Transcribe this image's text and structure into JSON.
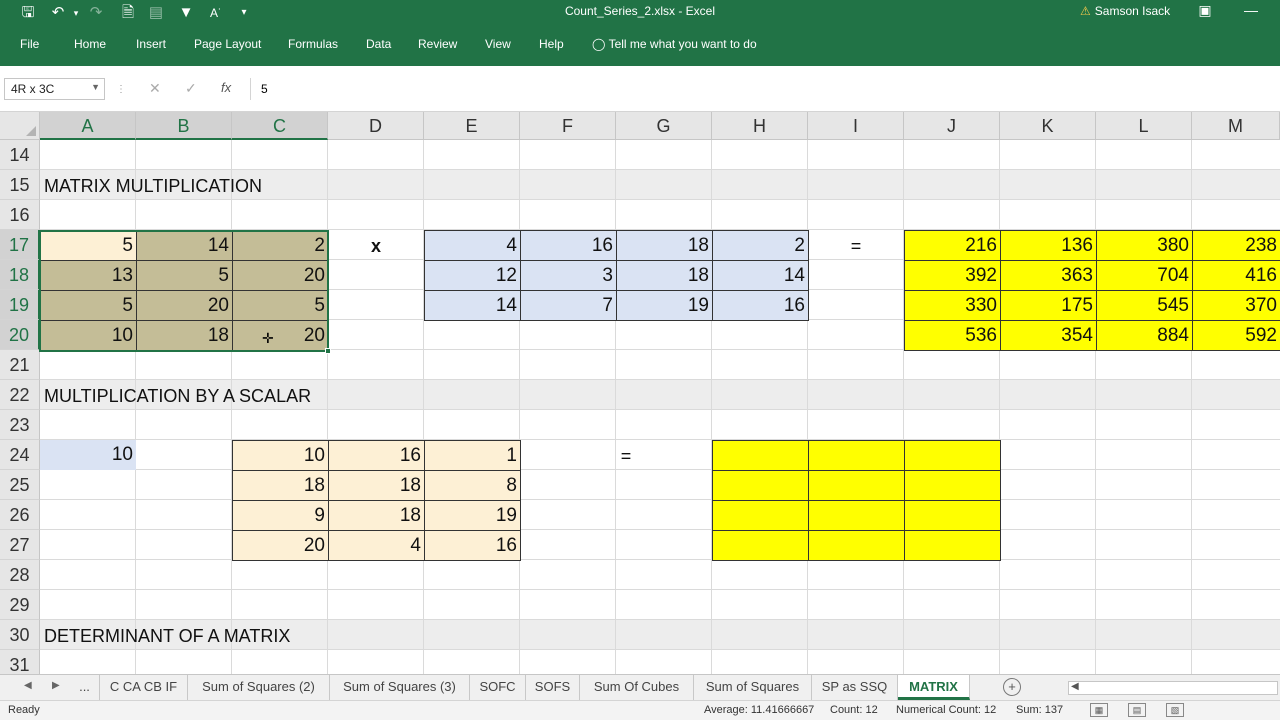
{
  "titlebar": {
    "title": "Count_Series_2.xlsx  -  Excel",
    "user": "Samson Isack",
    "icons": [
      "save-icon",
      "undo-icon",
      "redo-icon",
      "new-icon",
      "chart-icon",
      "filter-icon",
      "font-icon",
      "customize-icon"
    ]
  },
  "ribbon": {
    "tabs": [
      "File",
      "Home",
      "Insert",
      "Page Layout",
      "Formulas",
      "Data",
      "Review",
      "View",
      "Help"
    ],
    "tell_me": "Tell me what you want to do"
  },
  "formula_bar": {
    "name_box": "4R x 3C",
    "fx": "fx",
    "value": "5"
  },
  "columns": [
    "A",
    "B",
    "C",
    "D",
    "E",
    "F",
    "G",
    "H",
    "I",
    "J",
    "K",
    "L",
    "M"
  ],
  "rows": [
    "14",
    "15",
    "16",
    "17",
    "18",
    "19",
    "20",
    "21",
    "22",
    "23",
    "24",
    "25",
    "26",
    "27",
    "28",
    "29",
    "30",
    "31"
  ],
  "sheet": {
    "section_matrix_mult": "MATRIX MULTIPLICATION",
    "section_scalar": "MULTIPLICATION BY A SCALAR",
    "section_determinant": "DETERMINANT OF A MATRIX",
    "times_symbol": "x",
    "equals_symbol": "=",
    "matrix_a": [
      [
        "5",
        "14",
        "2"
      ],
      [
        "13",
        "5",
        "20"
      ],
      [
        "5",
        "20",
        "5"
      ],
      [
        "10",
        "18",
        "20"
      ]
    ],
    "matrix_b": [
      [
        "4",
        "16",
        "18",
        "2"
      ],
      [
        "12",
        "3",
        "18",
        "14"
      ],
      [
        "14",
        "7",
        "19",
        "16"
      ]
    ],
    "matrix_result": [
      [
        "216",
        "136",
        "380",
        "238"
      ],
      [
        "392",
        "363",
        "704",
        "416"
      ],
      [
        "330",
        "175",
        "545",
        "370"
      ],
      [
        "536",
        "354",
        "884",
        "592"
      ]
    ],
    "scalar": "10",
    "matrix_scalar": [
      [
        "10",
        "16",
        "1"
      ],
      [
        "18",
        "18",
        "8"
      ],
      [
        "9",
        "18",
        "19"
      ],
      [
        "20",
        "4",
        "16"
      ]
    ]
  },
  "sheet_tabs": [
    "...",
    "C CA CB IF",
    "Sum of Squares (2)",
    "Sum of Squares (3)",
    "SOFC",
    "SOFS",
    "Sum Of Cubes",
    "Sum of Squares",
    "SP as SSQ",
    "MATRIX"
  ],
  "active_tab": "MATRIX",
  "status": {
    "ready": "Ready",
    "average": "Average: 11.41666667",
    "count": "Count: 12",
    "numerical_count": "Numerical Count: 12",
    "sum": "Sum: 137"
  },
  "colors": {
    "excel_green": "#217346",
    "result_yellow": "#ffff00",
    "selection_tan": "#c4bd97",
    "blue_fill": "#dae3f3",
    "peach_fill": "#fdf0d5"
  }
}
